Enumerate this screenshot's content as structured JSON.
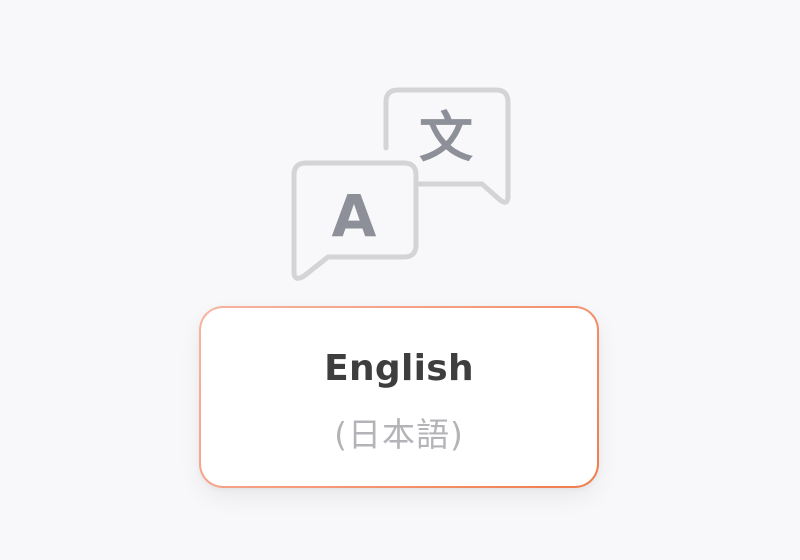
{
  "illustration": {
    "icon": "translate-icon",
    "latin_glyph": "A",
    "cjk_glyph": "文",
    "bubble_color": "#d4d4d6",
    "glyph_color": "#8e9099"
  },
  "language_option": {
    "primary_label": "English",
    "secondary_label": "(日本語)",
    "border_gradient": [
      "#f7b4a2",
      "#ee7d4d"
    ]
  },
  "colors": {
    "background": "#f8f8fa",
    "card_background": "#ffffff",
    "primary_text": "#3e3e3e",
    "secondary_text": "#b4b4b8"
  }
}
